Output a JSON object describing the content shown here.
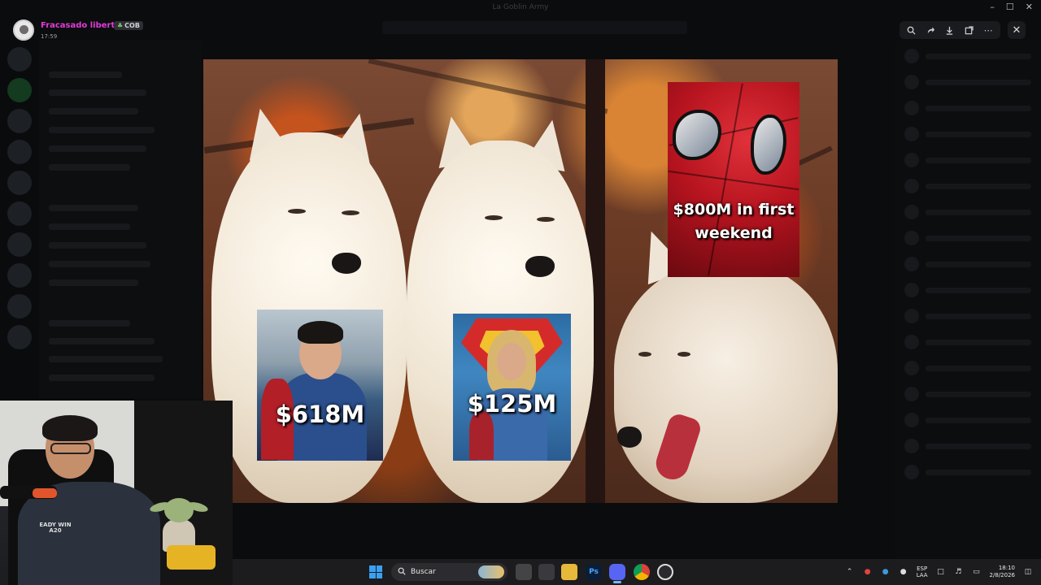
{
  "window": {
    "title": "La Goblin Army"
  },
  "uploader": {
    "name": "Fracasado libert...",
    "tag": "COB",
    "time": "17:59"
  },
  "toolbar": {
    "zoom_icon": "zoom-in-icon",
    "forward_icon": "forward-icon",
    "download_icon": "download-icon",
    "open_external_icon": "open-external-icon",
    "more_icon": "more-icon",
    "close_icon": "close-icon"
  },
  "meme": {
    "superman_label": "$618M",
    "supergirl_label": "$125M",
    "spiderman_label_line1": "$800M in first",
    "spiderman_label_line2": "weekend"
  },
  "webcam": {
    "hoodie_text": "EADY WIN A20"
  },
  "taskbar": {
    "search_placeholder": "Buscar",
    "ps_label": "Ps",
    "lang_line1": "ESP",
    "lang_line2": "LAA",
    "clock_time": "18:10",
    "clock_date": "2/8/2026"
  },
  "colors": {
    "uploader_name": "#e33bd8",
    "accent": "#76b9ed",
    "taskbar_bg": "#1c1c1f"
  }
}
